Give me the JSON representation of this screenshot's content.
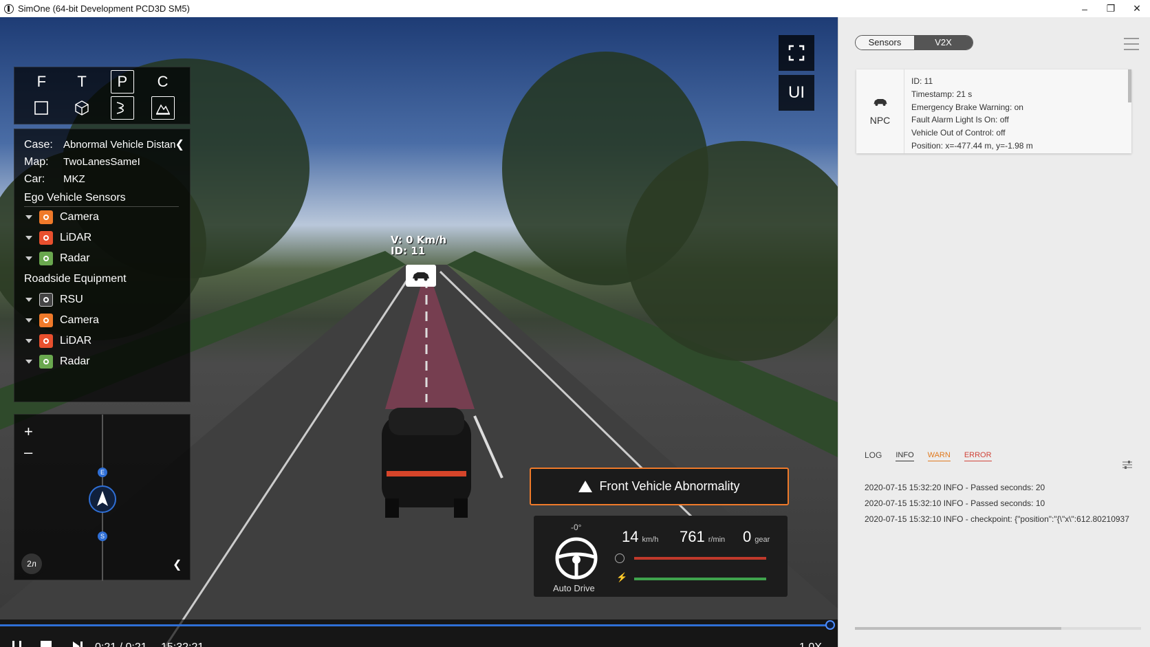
{
  "window": {
    "title": "SimOne (64-bit Development PCD3D SM5)",
    "controls": [
      "–",
      "❐",
      "✕"
    ]
  },
  "view_panel": {
    "modes": [
      "F",
      "T",
      "P",
      "C"
    ],
    "active_mode": "P",
    "tools": [
      "square-icon",
      "cube-icon",
      "path-icon",
      "terrain-icon"
    ]
  },
  "info": {
    "case_label": "Case:",
    "case_value": "Abnormal Vehicle Distance",
    "map_label": "Map:",
    "map_value": "TwoLanesSameI",
    "car_label": "Car:",
    "car_value": "MKZ",
    "ego_title": "Ego Vehicle Sensors",
    "ego_sensors": [
      {
        "label": "Camera",
        "color": "#f07a2a"
      },
      {
        "label": "LiDAR",
        "color": "#e8502e"
      },
      {
        "label": "Radar",
        "color": "#6aa84f"
      }
    ],
    "roadside_title": "Roadside Equipment",
    "roadside": [
      {
        "label": "RSU",
        "color": "#444444"
      },
      {
        "label": "Camera",
        "color": "#f07a2a"
      },
      {
        "label": "LiDAR",
        "color": "#e8502e"
      },
      {
        "label": "Radar",
        "color": "#6aa84f"
      }
    ]
  },
  "map": {
    "zoom_in": "+",
    "zoom_out": "–",
    "marker_e": "E",
    "marker_s": "S",
    "scale_text": "2л"
  },
  "scene": {
    "npc_label_v": "V: 0 Km/h",
    "npc_label_id": "ID: 11"
  },
  "overlay": {
    "ui_label": "UI",
    "alert_text": "Front Vehicle Abnormality"
  },
  "dashboard": {
    "steer_angle": "-0°",
    "mode": "Auto Drive",
    "speed": "14",
    "speed_unit": "km/h",
    "rpm": "761",
    "rpm_unit": "r/min",
    "gear": "0",
    "gear_unit": "gear",
    "brake_level": 1.0,
    "throttle_level": 1.0
  },
  "playback": {
    "time": "0:21 / 0:21",
    "clock": "15:32:21",
    "speed": "1.0X",
    "progress": 1.0
  },
  "right_panel": {
    "tabs": [
      "Sensors",
      "V2X"
    ],
    "active_tab": "V2X",
    "card": {
      "type": "NPC",
      "lines": [
        "ID: 11",
        "Timestamp:  21 s",
        "Emergency Brake Warning: on",
        "Fault Alarm Light Is On: off",
        "Vehicle Out of Control:  off",
        "Position: x=-477.44 m, y=-1.98 m"
      ]
    },
    "log": {
      "title": "LOG",
      "tabs": [
        {
          "label": "INFO",
          "color": "#333333"
        },
        {
          "label": "WARN",
          "color": "#e07a1f"
        },
        {
          "label": "ERROR",
          "color": "#d0453a"
        }
      ],
      "entries": [
        "2020-07-15 15:32:20 INFO - Passed seconds: 20",
        "2020-07-15 15:32:10 INFO - Passed seconds: 10",
        "2020-07-15 15:32:10 INFO - checkpoint: {\"position\":\"{\\\"x\\\":612.80210937"
      ]
    }
  }
}
